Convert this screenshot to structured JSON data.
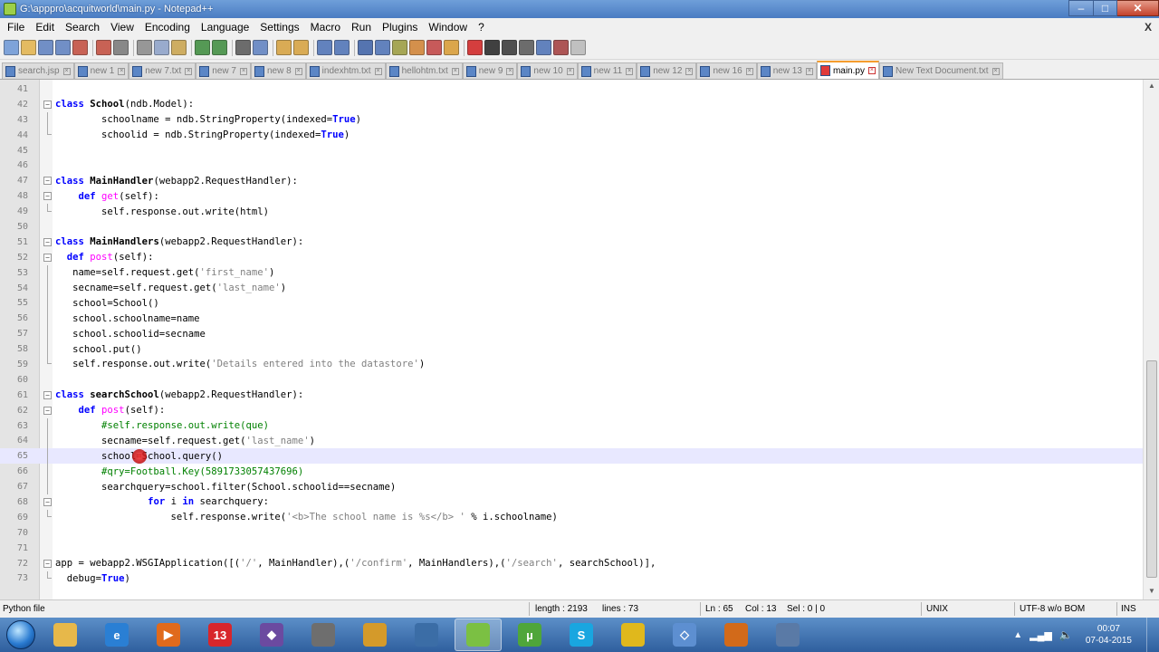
{
  "window": {
    "title": "G:\\apppro\\acquitworld\\main.py - Notepad++",
    "min": "–",
    "max": "□",
    "close": "✕"
  },
  "menu": [
    "File",
    "Edit",
    "Search",
    "View",
    "Encoding",
    "Language",
    "Settings",
    "Macro",
    "Run",
    "Plugins",
    "Window",
    "?"
  ],
  "menu_close": "X",
  "toolbar_icons": [
    "new-file-icon",
    "open-file-icon",
    "save-icon",
    "save-all-icon",
    "close-icon",
    "close-all-icon",
    "print-icon",
    "cut-icon",
    "copy-icon",
    "paste-icon",
    "undo-icon",
    "redo-icon",
    "find-icon",
    "replace-icon",
    "zoom-in-icon",
    "zoom-out-icon",
    "sync-v-icon",
    "sync-h-icon",
    "word-wrap-icon",
    "all-chars-icon",
    "indent-guide-icon",
    "doc-map-icon",
    "function-list-icon",
    "folder-workspace-icon",
    "record-macro-icon",
    "stop-record-icon",
    "play-macro-icon",
    "play-multiple-icon",
    "save-macro-icon",
    "spellcheck-icon",
    "launch-icon"
  ],
  "tabs": [
    {
      "label": "search.jsp",
      "active": false
    },
    {
      "label": "new  1",
      "active": false
    },
    {
      "label": "new  7.txt",
      "active": false
    },
    {
      "label": "new  7",
      "active": false
    },
    {
      "label": "new  8",
      "active": false
    },
    {
      "label": "indexhtm.txt",
      "active": false
    },
    {
      "label": "hellohtm.txt",
      "active": false
    },
    {
      "label": "new  9",
      "active": false
    },
    {
      "label": "new  10",
      "active": false
    },
    {
      "label": "new  11",
      "active": false
    },
    {
      "label": "new  12",
      "active": false
    },
    {
      "label": "new  16",
      "active": false
    },
    {
      "label": "new  13",
      "active": false
    },
    {
      "label": "main.py",
      "active": true
    },
    {
      "label": "New Text Document.txt",
      "active": false
    }
  ],
  "code_lines": [
    {
      "n": "41",
      "fold": "",
      "html": ""
    },
    {
      "n": "42",
      "fold": "open",
      "html": "<span class='kw'>class</span> <span class='cls'>School</span>(ndb.Model):"
    },
    {
      "n": "43",
      "fold": "line",
      "html": "        schoolname = ndb.StringProperty(indexed=<span class='kw'>True</span>)"
    },
    {
      "n": "44",
      "fold": "end",
      "html": "        schoolid = ndb.StringProperty(indexed=<span class='kw'>True</span>)"
    },
    {
      "n": "45",
      "fold": "",
      "html": ""
    },
    {
      "n": "46",
      "fold": "",
      "html": ""
    },
    {
      "n": "47",
      "fold": "open",
      "html": "<span class='kw'>class</span> <span class='cls'>MainHandler</span>(webapp2.RequestHandler):"
    },
    {
      "n": "48",
      "fold": "open",
      "html": "    <span class='kw'>def</span> <span class='fn'>get</span>(self):"
    },
    {
      "n": "49",
      "fold": "end",
      "html": "        self.response.out.write(html)"
    },
    {
      "n": "50",
      "fold": "",
      "html": ""
    },
    {
      "n": "51",
      "fold": "open",
      "html": "<span class='kw'>class</span> <span class='cls'>MainHandlers</span>(webapp2.RequestHandler):"
    },
    {
      "n": "52",
      "fold": "open",
      "html": "  <span class='kw'>def</span> <span class='fn'>post</span>(self):"
    },
    {
      "n": "53",
      "fold": "line",
      "html": "   name=self.request.get(<span class='str'>'first_name'</span>)"
    },
    {
      "n": "54",
      "fold": "line",
      "html": "   secname=self.request.get(<span class='str'>'last_name'</span>)"
    },
    {
      "n": "55",
      "fold": "line",
      "html": "   school=School()"
    },
    {
      "n": "56",
      "fold": "line",
      "html": "   school.schoolname=name"
    },
    {
      "n": "57",
      "fold": "line",
      "html": "   school.schoolid=secname"
    },
    {
      "n": "58",
      "fold": "line",
      "html": "   school.put()"
    },
    {
      "n": "59",
      "fold": "end",
      "html": "   self.response.out.write(<span class='str'>'Details entered into the datastore'</span>)"
    },
    {
      "n": "60",
      "fold": "",
      "html": ""
    },
    {
      "n": "61",
      "fold": "open",
      "html": "<span class='kw'>class</span> <span class='cls'>searchSchool</span>(webapp2.RequestHandler):"
    },
    {
      "n": "62",
      "fold": "open",
      "html": "    <span class='kw'>def</span> <span class='fn'>post</span>(self):"
    },
    {
      "n": "63",
      "fold": "line",
      "html": "        <span class='cmt'>#self.response.out.write(que)</span>"
    },
    {
      "n": "64",
      "fold": "line",
      "html": "        secname=self.request.get(<span class='str'>'last_name'</span>)"
    },
    {
      "n": "65",
      "fold": "line",
      "html": "        school=School.query()",
      "current": true
    },
    {
      "n": "66",
      "fold": "line",
      "html": "        <span class='cmt'>#qry=Football.Key(5891733057437696)</span>"
    },
    {
      "n": "67",
      "fold": "line",
      "html": "        searchquery=school.filter(School.schoolid==secname)"
    },
    {
      "n": "68",
      "fold": "open",
      "html": "                <span class='kw'>for</span> i <span class='kw'>in</span> searchquery:"
    },
    {
      "n": "69",
      "fold": "end",
      "html": "                    self.response.write(<span class='str'>'&lt;b&gt;The school name is %s&lt;/b&gt; '</span> % i.schoolname)"
    },
    {
      "n": "70",
      "fold": "",
      "html": ""
    },
    {
      "n": "71",
      "fold": "",
      "html": ""
    },
    {
      "n": "72",
      "fold": "open",
      "html": "app = webapp2.WSGIApplication([(<span class='str'>'/'</span>, MainHandler),(<span class='str'>'/confirm'</span>, MainHandlers),(<span class='str'>'/search'</span>, searchSchool)],"
    },
    {
      "n": "73",
      "fold": "end",
      "html": "  debug=<span class='kw'>True</span>)"
    }
  ],
  "status": {
    "filetype": "Python file",
    "length": "length : 2193",
    "lines": "lines : 73",
    "ln": "Ln : 65",
    "col": "Col : 13",
    "sel": "Sel : 0 | 0",
    "eol": "UNIX",
    "encoding": "UTF-8 w/o BOM",
    "ins": "INS"
  },
  "taskbar": {
    "apps": [
      {
        "name": "explorer",
        "color": "#e7b84a",
        "glyph": ""
      },
      {
        "name": "internet-explorer",
        "color": "#2a7fd4",
        "glyph": "e"
      },
      {
        "name": "media-player",
        "color": "#e06a1c",
        "glyph": "▶"
      },
      {
        "name": "app-13",
        "color": "#d8262b",
        "glyph": "13"
      },
      {
        "name": "gem-app",
        "color": "#6b4aa0",
        "glyph": "◆"
      },
      {
        "name": "calculator",
        "color": "#6e6e6e",
        "glyph": ""
      },
      {
        "name": "folder-app",
        "color": "#d49a2a",
        "glyph": ""
      },
      {
        "name": "python",
        "color": "#3b6da6",
        "glyph": ""
      },
      {
        "name": "notepadpp",
        "color": "#7bc043",
        "glyph": ""
      },
      {
        "name": "utorrent",
        "color": "#4fa63a",
        "glyph": "µ"
      },
      {
        "name": "skype",
        "color": "#19a6e0",
        "glyph": "S"
      },
      {
        "name": "chrome",
        "color": "#e0b81c",
        "glyph": ""
      },
      {
        "name": "app-kite",
        "color": "#5d8fd1",
        "glyph": "◇"
      },
      {
        "name": "winamp",
        "color": "#d26a1a",
        "glyph": ""
      },
      {
        "name": "floppy",
        "color": "#5a7aa6",
        "glyph": ""
      }
    ],
    "active_index": 8,
    "time": "00:07",
    "date": "07-04-2015"
  }
}
